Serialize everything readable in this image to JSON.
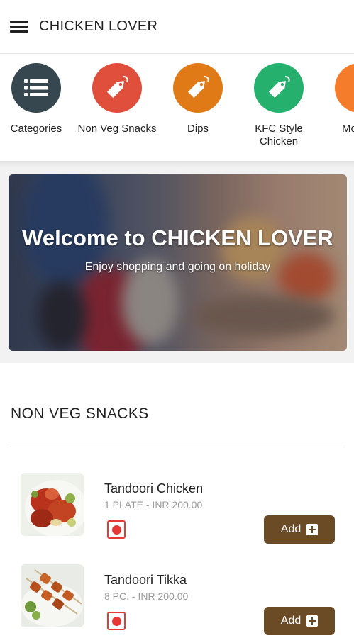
{
  "app": {
    "title": "CHICKEN LOVER",
    "menu_icon": "hamburger-menu-icon"
  },
  "categories": [
    {
      "label": "Categories",
      "color": "#37474f",
      "icon": "list-icon"
    },
    {
      "label": "Non Veg Snacks",
      "color": "#e04e3c",
      "icon": "tag-icon"
    },
    {
      "label": "Dips",
      "color": "#e07a16",
      "icon": "tag-icon"
    },
    {
      "label": "KFC Style Chicken",
      "color": "#26b06d",
      "icon": "tag-icon"
    },
    {
      "label": "Mo",
      "color": "#f57c2a",
      "icon": "tag-icon"
    }
  ],
  "banner": {
    "title": "Welcome to CHICKEN LOVER",
    "subtitle": "Enjoy shopping and going on holiday"
  },
  "section": {
    "title": "NON VEG SNACKS"
  },
  "products": [
    {
      "name": "Tandoori Chicken",
      "meta": "1 PLATE - INR 200.00",
      "add_label": "Add",
      "diet": "non-veg"
    },
    {
      "name": "Tandoori Tikka",
      "meta": "8 PC. - INR 200.00",
      "add_label": "Add",
      "diet": "non-veg"
    }
  ],
  "colors": {
    "accent": "#6b4a26",
    "nonveg": "#e53935"
  }
}
